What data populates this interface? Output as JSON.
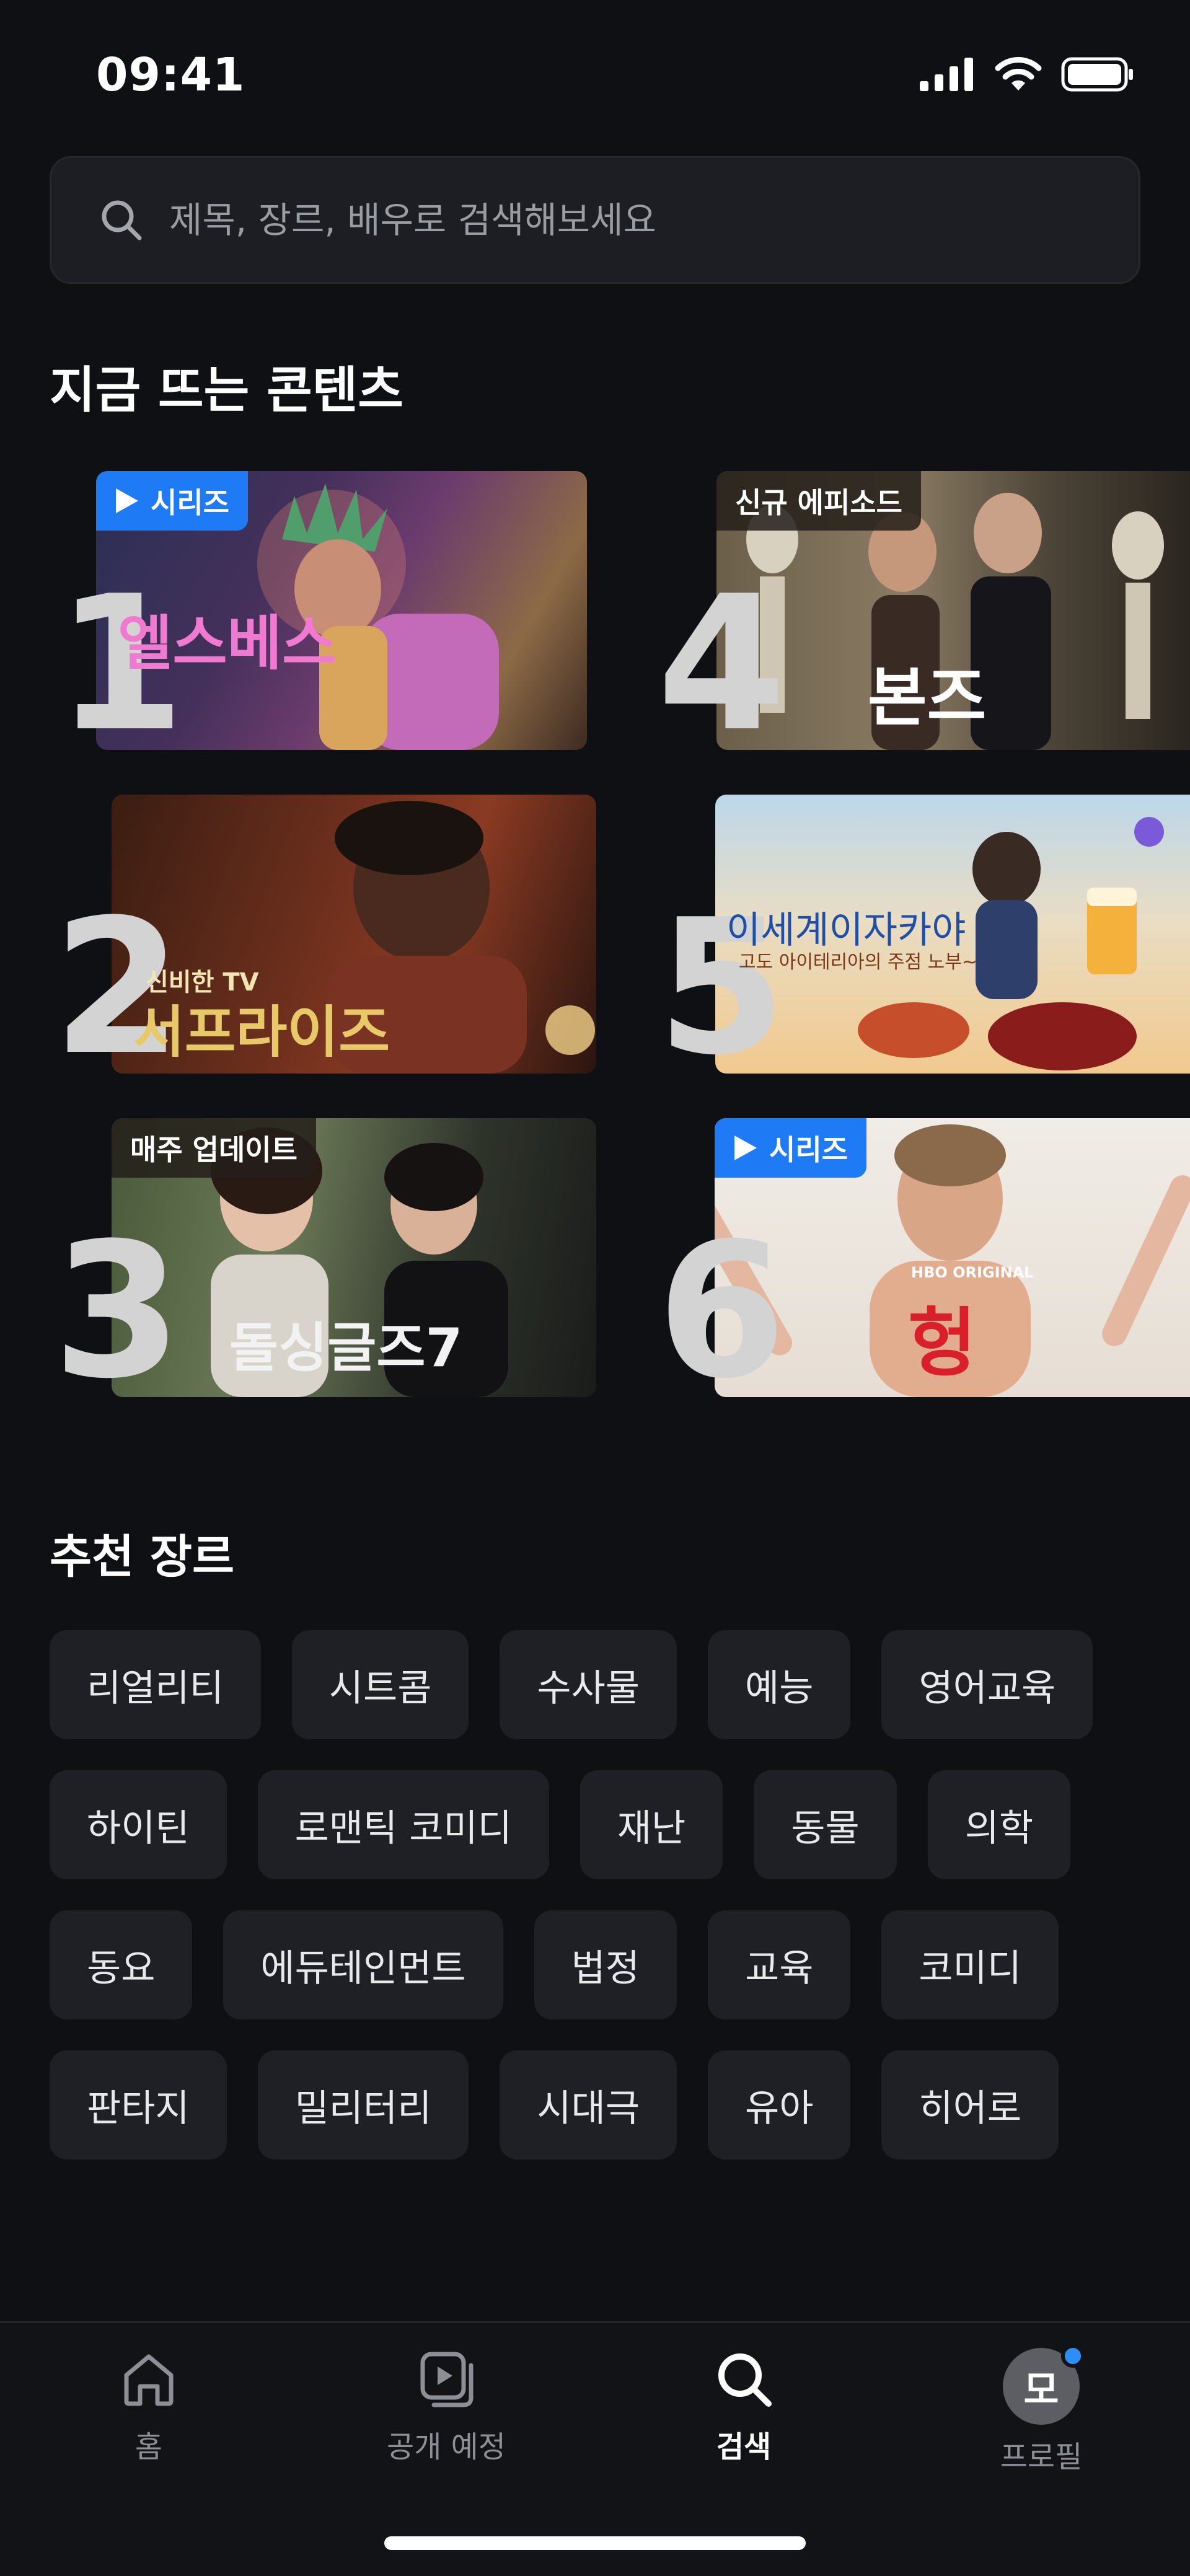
{
  "status_bar": {
    "time": "09:41"
  },
  "search": {
    "placeholder": "제목, 장르, 배우로 검색해보세요"
  },
  "trending": {
    "title": "지금 뜨는 콘텐츠",
    "items": [
      {
        "rank": "1",
        "title": "엘스베스",
        "badge": "시리즈",
        "badge_style": "blue"
      },
      {
        "rank": "2",
        "title": "서프라이즈",
        "title_small": "신비한 TV",
        "badge": ""
      },
      {
        "rank": "3",
        "title": "돌싱글즈7",
        "badge": "매주 업데이트",
        "badge_style": "dark"
      },
      {
        "rank": "4",
        "title": "본즈",
        "badge": "신규 에피소드",
        "badge_style": "dark"
      },
      {
        "rank": "5",
        "title": "이세계이자카야",
        "subtitle": "고도 아이테리아의 주점 노부~",
        "badge": ""
      },
      {
        "rank": "6",
        "title": "헝",
        "title_small": "HBO ORIGINAL",
        "badge": "시리즈",
        "badge_style": "blue"
      }
    ]
  },
  "genres": {
    "title": "추천 장르",
    "rows": [
      [
        "리얼리티",
        "시트콤",
        "수사물",
        "예능",
        "영어교육"
      ],
      [
        "하이틴",
        "로맨틱 코미디",
        "재난",
        "동물",
        "의학"
      ],
      [
        "동요",
        "에듀테인먼트",
        "법정",
        "교육",
        "코미디"
      ],
      [
        "판타지",
        "밀리터리",
        "시대극",
        "유아",
        "히어로"
      ]
    ]
  },
  "tab_bar": {
    "tabs": [
      {
        "label": "홈",
        "icon": "home-icon"
      },
      {
        "label": "공개 예정",
        "icon": "play-icon"
      },
      {
        "label": "검색",
        "icon": "search-icon",
        "active": true
      },
      {
        "label": "프로필",
        "icon": "avatar",
        "avatar_text": "모"
      }
    ]
  },
  "colors": {
    "accent": "#1f7bf5",
    "background": "#0f1014",
    "chip": "#1e2025"
  }
}
